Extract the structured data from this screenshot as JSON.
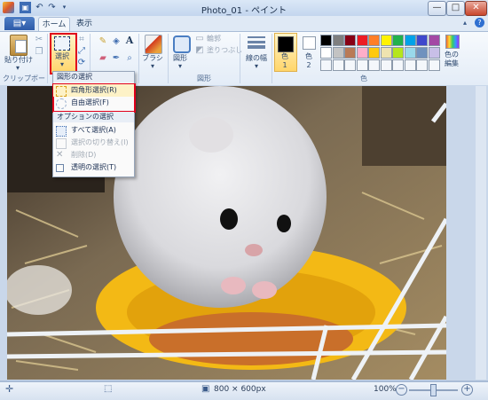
{
  "window": {
    "title": "Photo_01 - ペイント",
    "controls": [
      "—",
      "□",
      "✕"
    ]
  },
  "tabs": {
    "file": "▤▾",
    "home": "ホーム",
    "view": "表示"
  },
  "ribbon": {
    "clipboard": {
      "paste_label": "貼り付け",
      "group_label": "クリップボード"
    },
    "image": {
      "select_label": "選択"
    },
    "tools": {
      "text_tool": "A"
    },
    "brushes": {
      "label": "ブラシ"
    },
    "shapes": {
      "label": "図形",
      "outline_label": "輪郭",
      "fill_label": "塗りつぶし",
      "group_label": "図形"
    },
    "size": {
      "label": "線の幅"
    },
    "colors": {
      "color1_label": "色\n1",
      "color2_label": "色\n2",
      "edit_label": "色の\n編集",
      "group_label": "色",
      "color1": "#000000",
      "color2": "#ffffff",
      "palette_row1": [
        "#000000",
        "#7f7f7f",
        "#880015",
        "#ed1c24",
        "#ff7f27",
        "#fff200",
        "#22b14c",
        "#00a2e8",
        "#3f48cc",
        "#a349a4"
      ],
      "palette_row2": [
        "#ffffff",
        "#c3c3c3",
        "#b97a57",
        "#ffaec9",
        "#ffc90e",
        "#efe4b0",
        "#b5e61d",
        "#99d9ea",
        "#7092be",
        "#c8bfe7"
      ]
    }
  },
  "select_menu": {
    "shape_header": "図形の選択",
    "rect_select": "四角形選択(R)",
    "free_select": "自由選択(F)",
    "option_header": "オプションの選択",
    "select_all": "すべて選択(A)",
    "invert": "選択の切り替え(I)",
    "delete": "削除(D)",
    "transparent": "透明の選択(T)"
  },
  "status": {
    "size": "800 × 600px",
    "zoom": "100%"
  }
}
